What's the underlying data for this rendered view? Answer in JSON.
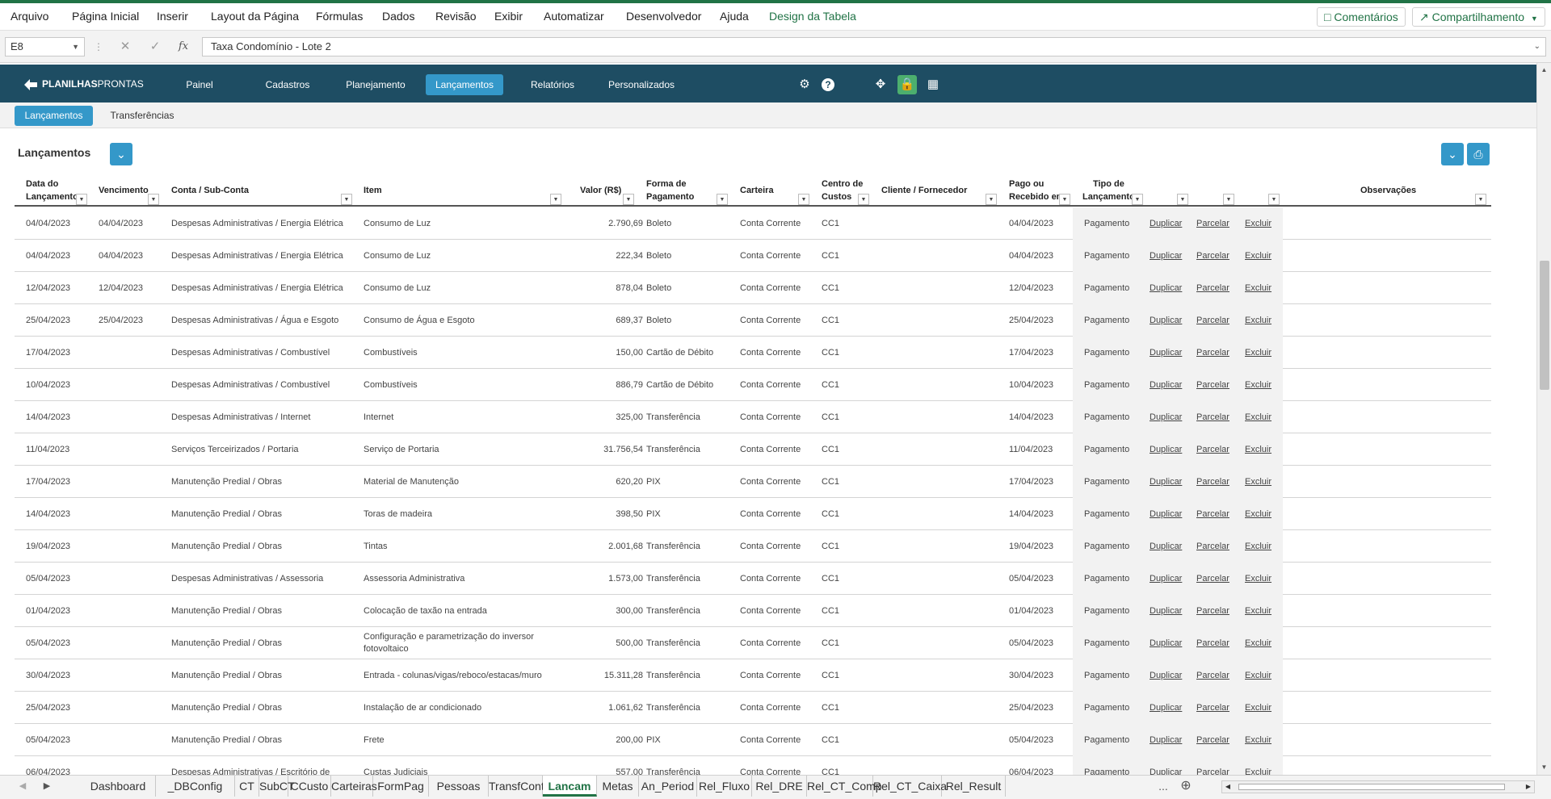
{
  "menu": {
    "items": [
      "Arquivo",
      "Página Inicial",
      "Inserir",
      "Layout da Página",
      "Fórmulas",
      "Dados",
      "Revisão",
      "Exibir",
      "Automatizar",
      "Desenvolvedor",
      "Ajuda",
      "Design da Tabela"
    ],
    "comments": "Comentários",
    "share": "Compartilhamento"
  },
  "formula_bar": {
    "name_box": "E8",
    "fx": "fx",
    "content": "Taxa Condomínio - Lote 2"
  },
  "app_nav": {
    "logo": "PLANILHAS",
    "logo_suffix": "PRONTAS",
    "buttons": [
      "Painel",
      "Cadastros",
      "Planejamento",
      "Lançamentos",
      "Relatórios",
      "Personalizados"
    ],
    "active": "Lançamentos"
  },
  "sub_nav": {
    "buttons": [
      "Lançamentos",
      "Transferências"
    ],
    "active": "Lançamentos"
  },
  "page": {
    "title": "Lançamentos"
  },
  "table": {
    "headers": [
      "Data do\nLançamento",
      "Vencimento",
      "Conta / Sub-Conta",
      "Item",
      "Valor (R$)",
      "Forma de\nPagamento",
      "Carteira",
      "Centro de\nCustos",
      "Cliente / Fornecedor",
      "Pago ou\nRecebido em",
      "Tipo de\nLançamento",
      "Observações"
    ],
    "action_labels": [
      "Duplicar",
      "Parcelar",
      "Excluir"
    ],
    "rows": [
      {
        "data": "04/04/2023",
        "venc": "04/04/2023",
        "conta": "Despesas Administrativas / Energia Elétrica",
        "item": "Consumo de Luz",
        "valor": "2.790,69",
        "forma": "Boleto",
        "carteira": "Conta Corrente",
        "cc": "CC1",
        "pago": "04/04/2023",
        "tipo": "Pagamento"
      },
      {
        "data": "04/04/2023",
        "venc": "04/04/2023",
        "conta": "Despesas Administrativas / Energia Elétrica",
        "item": "Consumo de Luz",
        "valor": "222,34",
        "forma": "Boleto",
        "carteira": "Conta Corrente",
        "cc": "CC1",
        "pago": "04/04/2023",
        "tipo": "Pagamento"
      },
      {
        "data": "12/04/2023",
        "venc": "12/04/2023",
        "conta": "Despesas Administrativas / Energia Elétrica",
        "item": "Consumo de Luz",
        "valor": "878,04",
        "forma": "Boleto",
        "carteira": "Conta Corrente",
        "cc": "CC1",
        "pago": "12/04/2023",
        "tipo": "Pagamento"
      },
      {
        "data": "25/04/2023",
        "venc": "25/04/2023",
        "conta": "Despesas Administrativas / Água e Esgoto",
        "item": "Consumo de Água e Esgoto",
        "valor": "689,37",
        "forma": "Boleto",
        "carteira": "Conta Corrente",
        "cc": "CC1",
        "pago": "25/04/2023",
        "tipo": "Pagamento"
      },
      {
        "data": "17/04/2023",
        "venc": "",
        "conta": "Despesas Administrativas / Combustível",
        "item": "Combustíveis",
        "valor": "150,00",
        "forma": "Cartão de Débito",
        "carteira": "Conta Corrente",
        "cc": "CC1",
        "pago": "17/04/2023",
        "tipo": "Pagamento"
      },
      {
        "data": "10/04/2023",
        "venc": "",
        "conta": "Despesas Administrativas / Combustível",
        "item": "Combustíveis",
        "valor": "886,79",
        "forma": "Cartão de Débito",
        "carteira": "Conta Corrente",
        "cc": "CC1",
        "pago": "10/04/2023",
        "tipo": "Pagamento"
      },
      {
        "data": "14/04/2023",
        "venc": "",
        "conta": "Despesas Administrativas / Internet",
        "item": "Internet",
        "valor": "325,00",
        "forma": "Transferência",
        "carteira": "Conta Corrente",
        "cc": "CC1",
        "pago": "14/04/2023",
        "tipo": "Pagamento"
      },
      {
        "data": "11/04/2023",
        "venc": "",
        "conta": "Serviços Terceirizados / Portaria",
        "item": "Serviço de Portaria",
        "valor": "31.756,54",
        "forma": "Transferência",
        "carteira": "Conta Corrente",
        "cc": "CC1",
        "pago": "11/04/2023",
        "tipo": "Pagamento"
      },
      {
        "data": "17/04/2023",
        "venc": "",
        "conta": "Manutenção Predial / Obras",
        "item": "Material de Manutenção",
        "valor": "620,20",
        "forma": "PIX",
        "carteira": "Conta Corrente",
        "cc": "CC1",
        "pago": "17/04/2023",
        "tipo": "Pagamento"
      },
      {
        "data": "14/04/2023",
        "venc": "",
        "conta": "Manutenção Predial / Obras",
        "item": "Toras de madeira",
        "valor": "398,50",
        "forma": "PIX",
        "carteira": "Conta Corrente",
        "cc": "CC1",
        "pago": "14/04/2023",
        "tipo": "Pagamento"
      },
      {
        "data": "19/04/2023",
        "venc": "",
        "conta": "Manutenção Predial / Obras",
        "item": "Tintas",
        "valor": "2.001,68",
        "forma": "Transferência",
        "carteira": "Conta Corrente",
        "cc": "CC1",
        "pago": "19/04/2023",
        "tipo": "Pagamento"
      },
      {
        "data": "05/04/2023",
        "venc": "",
        "conta": "Despesas Administrativas / Assessoria",
        "item": "Assessoria Administrativa",
        "valor": "1.573,00",
        "forma": "Transferência",
        "carteira": "Conta Corrente",
        "cc": "CC1",
        "pago": "05/04/2023",
        "tipo": "Pagamento"
      },
      {
        "data": "01/04/2023",
        "venc": "",
        "conta": "Manutenção Predial / Obras",
        "item": "Colocação de taxão na entrada",
        "valor": "300,00",
        "forma": "Transferência",
        "carteira": "Conta Corrente",
        "cc": "CC1",
        "pago": "01/04/2023",
        "tipo": "Pagamento"
      },
      {
        "data": "05/04/2023",
        "venc": "",
        "conta": "Manutenção Predial / Obras",
        "item": "Configuração e parametrização do inversor fotovoltaico",
        "valor": "500,00",
        "forma": "Transferência",
        "carteira": "Conta Corrente",
        "cc": "CC1",
        "pago": "05/04/2023",
        "tipo": "Pagamento"
      },
      {
        "data": "30/04/2023",
        "venc": "",
        "conta": "Manutenção Predial / Obras",
        "item": "Entrada - colunas/vigas/reboco/estacas/muro",
        "valor": "15.311,28",
        "forma": "Transferência",
        "carteira": "Conta Corrente",
        "cc": "CC1",
        "pago": "30/04/2023",
        "tipo": "Pagamento"
      },
      {
        "data": "25/04/2023",
        "venc": "",
        "conta": "Manutenção Predial / Obras",
        "item": "Instalação de ar condicionado",
        "valor": "1.061,62",
        "forma": "Transferência",
        "carteira": "Conta Corrente",
        "cc": "CC1",
        "pago": "25/04/2023",
        "tipo": "Pagamento"
      },
      {
        "data": "05/04/2023",
        "venc": "",
        "conta": "Manutenção Predial / Obras",
        "item": "Frete",
        "valor": "200,00",
        "forma": "PIX",
        "carteira": "Conta Corrente",
        "cc": "CC1",
        "pago": "05/04/2023",
        "tipo": "Pagamento"
      },
      {
        "data": "06/04/2023",
        "venc": "",
        "conta": "Despesas Administrativas / Escritório de",
        "item": "Custas Judiciais",
        "valor": "557,00",
        "forma": "Transferência",
        "carteira": "Conta Corrente",
        "cc": "CC1",
        "pago": "06/04/2023",
        "tipo": "Pagamento"
      }
    ]
  },
  "sheet_tabs": {
    "tabs": [
      "Dashboard",
      "_DBConfig",
      "CT",
      "SubCT",
      "CCusto",
      "Carteiras",
      "FormPag",
      "Pessoas",
      "TransfCont",
      "Lancam",
      "Metas",
      "An_Period",
      "Rel_Fluxo",
      "Rel_DRE",
      "Rel_CT_Comp",
      "Rel_CT_Caixa",
      "Rel_Result"
    ],
    "active": "Lancam",
    "more": "...",
    "add": "⊕"
  }
}
